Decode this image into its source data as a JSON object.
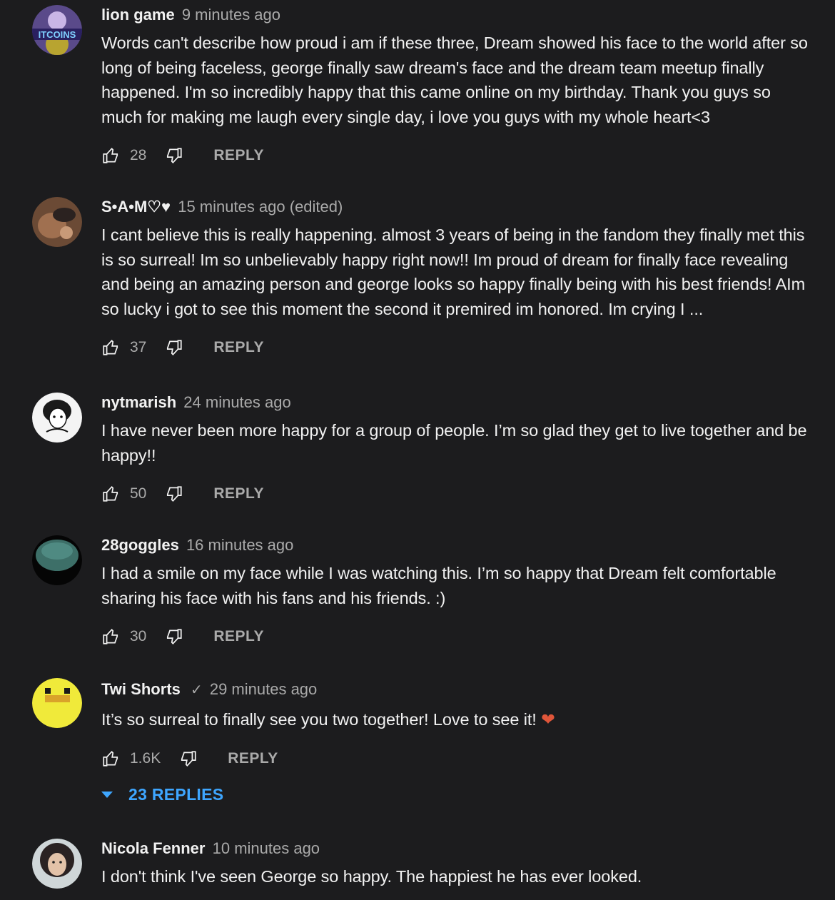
{
  "comments": [
    {
      "author": "lion game",
      "time": "9 minutes ago",
      "text": "Words can't describe how proud i am if these three, Dream showed his face to the world after so long of being faceless, george finally saw dream's face and the dream team meetup finally happened. I'm so incredibly happy that this came online on my birthday. Thank you guys so much for making me laugh every single day, i love you guys with my whole heart<3",
      "likes": "28",
      "reply_label": "REPLY",
      "avatar_text": "ITCOINS"
    },
    {
      "author": "S•A•M♡♥",
      "time": "15 minutes ago (edited)",
      "text": "I cant believe this is really happening. almost 3 years of being in the fandom they finally met this is so surreal! Im so unbelievably happy right now!! Im proud of dream for finally face revealing and being an amazing person and george looks so happy finally being with his best friends! AIm so lucky i got to see this moment the second it premired im honored. Im crying I ...",
      "likes": "37",
      "reply_label": "REPLY"
    },
    {
      "author": "nytmarish",
      "time": "24 minutes ago",
      "text": "I have never been more happy for a group of people. I’m so glad they get to live together and be happy!!",
      "likes": "50",
      "reply_label": "REPLY"
    },
    {
      "author": "28goggles",
      "time": "16 minutes ago",
      "text": "I had a smile on my face while I was watching this. I’m so happy that Dream felt comfortable sharing his face with his fans and his friends. :)",
      "likes": "30",
      "reply_label": "REPLY"
    },
    {
      "author": "Twi Shorts",
      "verified_icon": "checkmark-icon",
      "time": "29 minutes ago",
      "text": "It’s so surreal to finally see you two together! Love to see it! ",
      "emoji": "❤",
      "likes": "1.6K",
      "reply_label": "REPLY",
      "replies_label": "23 REPLIES"
    },
    {
      "author": "Nicola Fenner",
      "time": "10 minutes ago",
      "text": "I don't think I've seen George so happy. The happiest he has ever looked."
    }
  ],
  "icons": {
    "like": "thumbs-up-icon",
    "dislike": "thumbs-down-icon",
    "expand": "caret-down-icon"
  },
  "colors": {
    "background": "#1c1c1e",
    "text": "#f1f1f1",
    "meta": "#aaaaaa",
    "link": "#3ea6ff"
  }
}
